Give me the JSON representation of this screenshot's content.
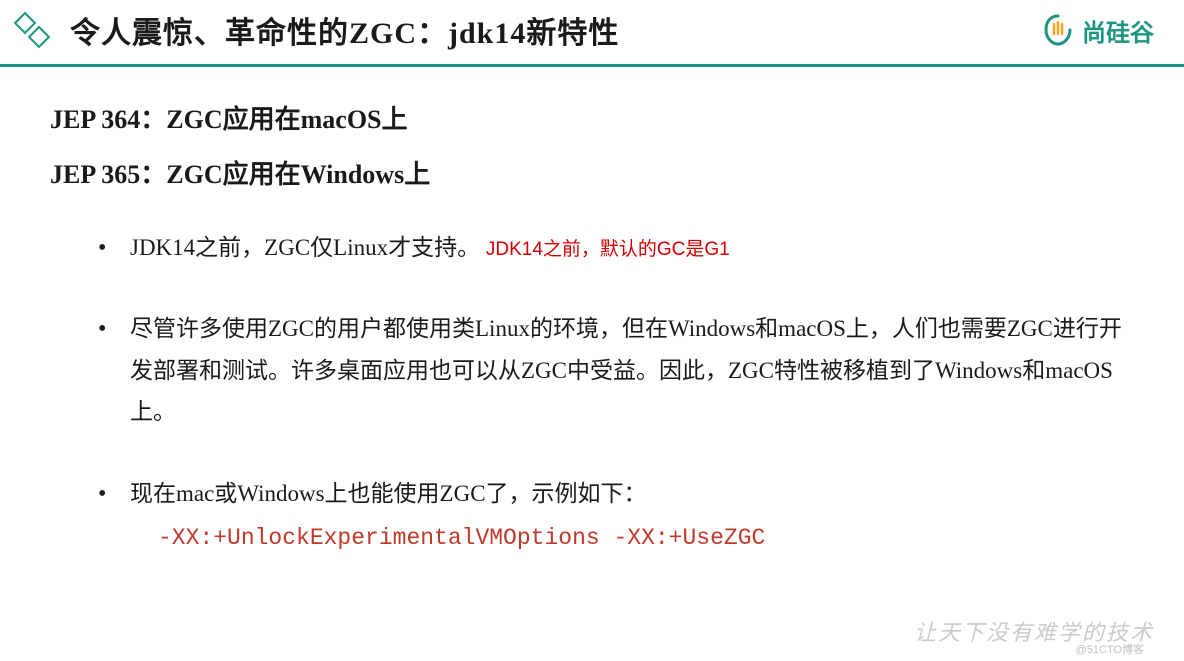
{
  "header": {
    "title": "令人震惊、革命性的ZGC：jdk14新特性",
    "brand": "尚硅谷"
  },
  "jep": {
    "line1": "JEP 364：ZGC应用在macOS上",
    "line2": "JEP 365：ZGC应用在Windows上"
  },
  "bullets": {
    "item1_text": "JDK14之前，ZGC仅Linux才支持。",
    "item1_note": "JDK14之前，默认的GC是G1",
    "item2": "尽管许多使用ZGC的用户都使用类Linux的环境，但在Windows和macOS上，人们也需要ZGC进行开发部署和测试。许多桌面应用也可以从ZGC中受益。因此，ZGC特性被移植到了Windows和macOS上。",
    "item3": "现在mac或Windows上也能使用ZGC了，示例如下：",
    "code": "-XX:+UnlockExperimentalVMOptions -XX:+UseZGC"
  },
  "footer": {
    "slogan": "让天下没有难学的技术",
    "watermark": "@51CTO博客"
  }
}
